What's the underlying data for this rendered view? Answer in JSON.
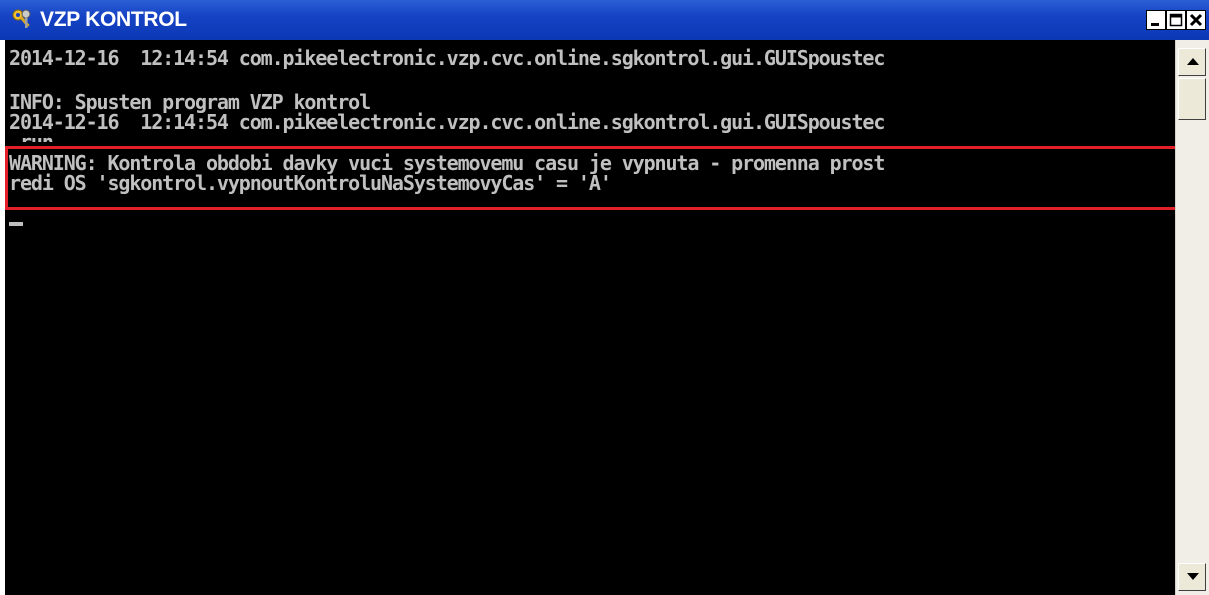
{
  "window": {
    "title": "VZP KONTROL",
    "icon": "keys-icon"
  },
  "console": {
    "lines": [
      "2014-12-16  12:14:54 com.pikeelectronic.vzp.cvc.online.sgkontrol.gui.GUISpoustec",
      "",
      "INFO: Spusten program VZP kontrol",
      "2014-12-16  12:14:54 com.pikeelectronic.vzp.cvc.online.sgkontrol.gui.GUISpoustec",
      " run",
      "WARNING: Kontrola obdobi davky vuci systemovemu casu je vypnuta - promenna prost",
      "redi OS 'sgkontrol.vypnoutKontroluNaSystemovyCas' = 'A'"
    ]
  },
  "colors": {
    "titlebar": "#0b38b5",
    "console_bg": "#000000",
    "console_text": "#c0c0c0",
    "highlight": "#e3202a"
  }
}
